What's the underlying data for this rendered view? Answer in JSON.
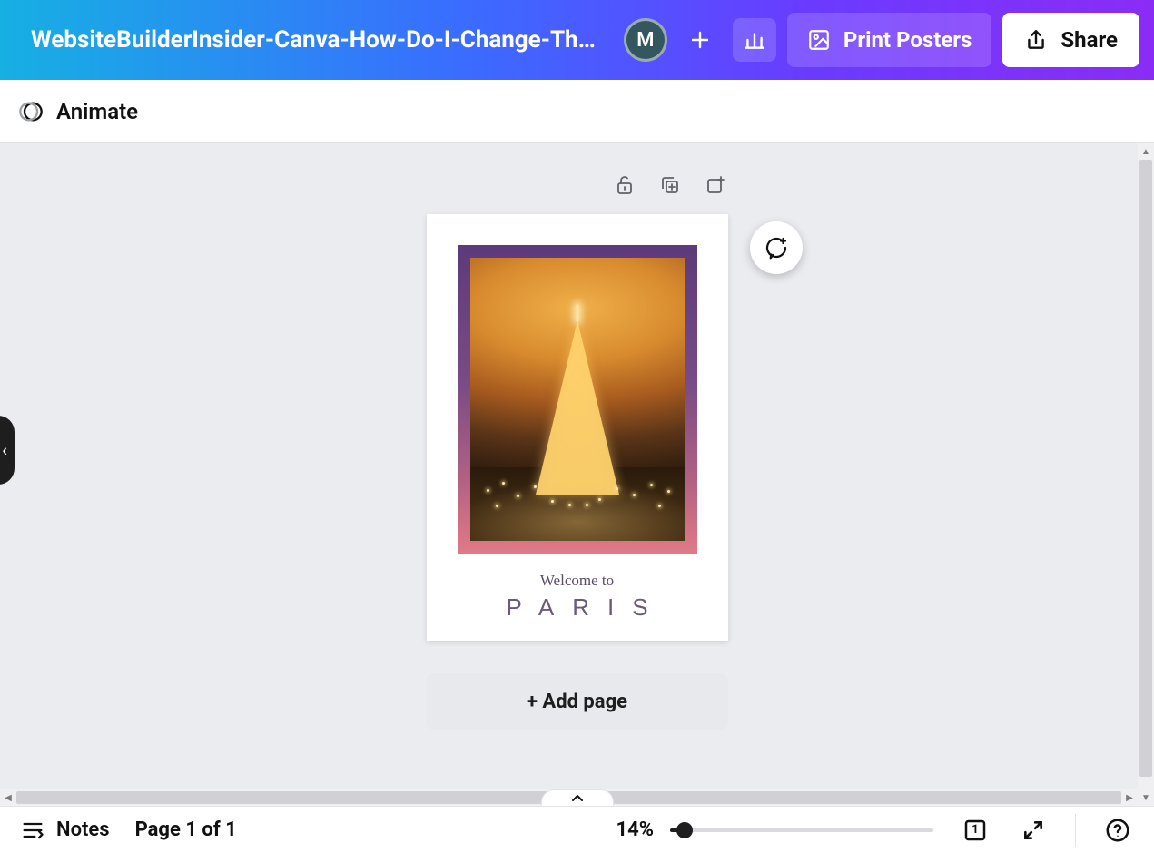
{
  "header": {
    "doc_title": "WebsiteBuilderInsider-Canva-How-Do-I-Change-The-Backg...",
    "avatar_initial": "M",
    "print_label": "Print Posters",
    "share_label": "Share"
  },
  "toolbar": {
    "animate_label": "Animate"
  },
  "canvas": {
    "poster": {
      "welcome_text": "Welcome to",
      "city_text": "PARIS"
    },
    "add_page_label": "+ Add page"
  },
  "footer": {
    "notes_label": "Notes",
    "page_indicator": "Page 1 of 1",
    "zoom_percent": "14%",
    "grid_page_badge": "1"
  }
}
